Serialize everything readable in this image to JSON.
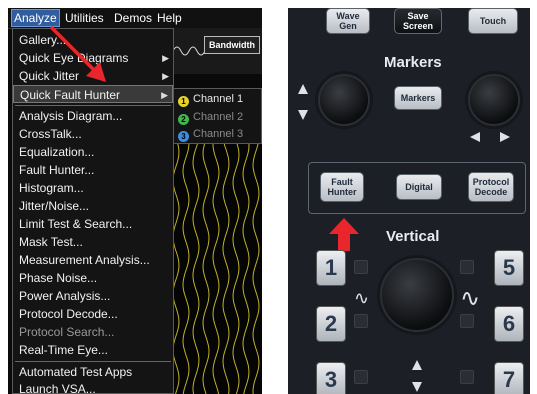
{
  "menubar": {
    "items": [
      "Analyze",
      "Utilities",
      "Demos",
      "Help"
    ]
  },
  "toolbar": {
    "bandwidth_label": "Bandwidth"
  },
  "analyze_menu": {
    "items": [
      "Gallery...",
      "Quick Eye Diagrams",
      "Quick Jitter",
      "Quick Fault Hunter",
      "Analysis Diagram...",
      "CrossTalk...",
      "Equalization...",
      "Fault Hunter...",
      "Histogram...",
      "Jitter/Noise...",
      "Limit Test & Search...",
      "Mask Test...",
      "Measurement Analysis...",
      "Phase Noise...",
      "Power Analysis...",
      "Protocol Decode...",
      "Protocol Search...",
      "Real-Time Eye...",
      "Automated Test Apps",
      "Launch VSA..."
    ]
  },
  "fault_hunter_submenu": {
    "channels": [
      {
        "num": "1",
        "label": "Channel 1",
        "color": "#e5d22a"
      },
      {
        "num": "2",
        "label": "Channel 2",
        "color": "#3fb84a"
      },
      {
        "num": "3",
        "label": "Channel 3",
        "color": "#3f8ee0"
      }
    ]
  },
  "panel": {
    "top_buttons": [
      "Wave Gen",
      "Save Screen",
      "Touch"
    ],
    "markers_title": "Markers",
    "markers_button": "Markers",
    "function_buttons": [
      "Fault Hunter",
      "Digital",
      "Protocol Decode"
    ],
    "vertical_title": "Vertical",
    "channel_keys": [
      "1",
      "5",
      "2",
      "6",
      "3",
      "7"
    ]
  },
  "colors": {
    "annotation_arrow": "#e8262b",
    "trace_yellow": "#e1d12f",
    "menu_highlight": "#2f5d9f"
  }
}
